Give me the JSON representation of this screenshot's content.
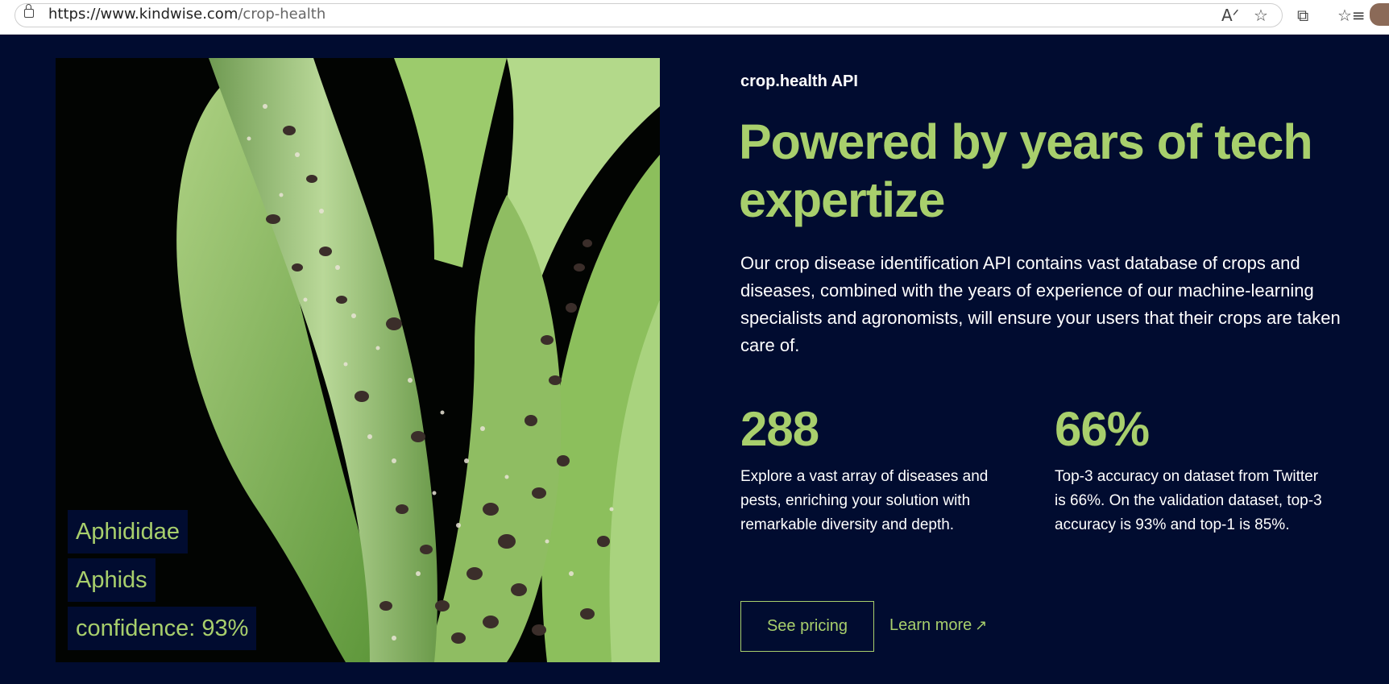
{
  "browser": {
    "url_main": "https://www.kindwise.com",
    "url_path": "/crop-health",
    "icons": [
      "lock-icon",
      "read-aloud-icon",
      "favorite-star-icon",
      "extensions-icon",
      "favorites-icon",
      "profile-avatar"
    ]
  },
  "photo": {
    "labels": [
      "Aphididae",
      "Aphids",
      "confidence: 93%"
    ]
  },
  "hero": {
    "eyebrow": "crop.health API",
    "headline": "Powered by years of tech expertize",
    "description": "Our crop disease identification API contains vast database of crops and diseases, combined with the years of experience of our machine-learning specialists and agronomists, will ensure your users that their crops are taken care of."
  },
  "stats": [
    {
      "value": "288",
      "text": "Explore a vast array of diseases and pests, enriching your solution with remarkable diversity and depth."
    },
    {
      "value": "66%",
      "text": "Top-3 accuracy on dataset from Twitter is 66%. On the validation dataset, top-3 accuracy is 93% and top-1 is 85%."
    }
  ],
  "cta": {
    "pricing_label": "See pricing",
    "learn_label": "Learn more",
    "learn_icon": "arrow-up-right-icon"
  },
  "colors": {
    "background": "#010c30",
    "accent": "#a8cf6c",
    "text": "#ffffff"
  }
}
